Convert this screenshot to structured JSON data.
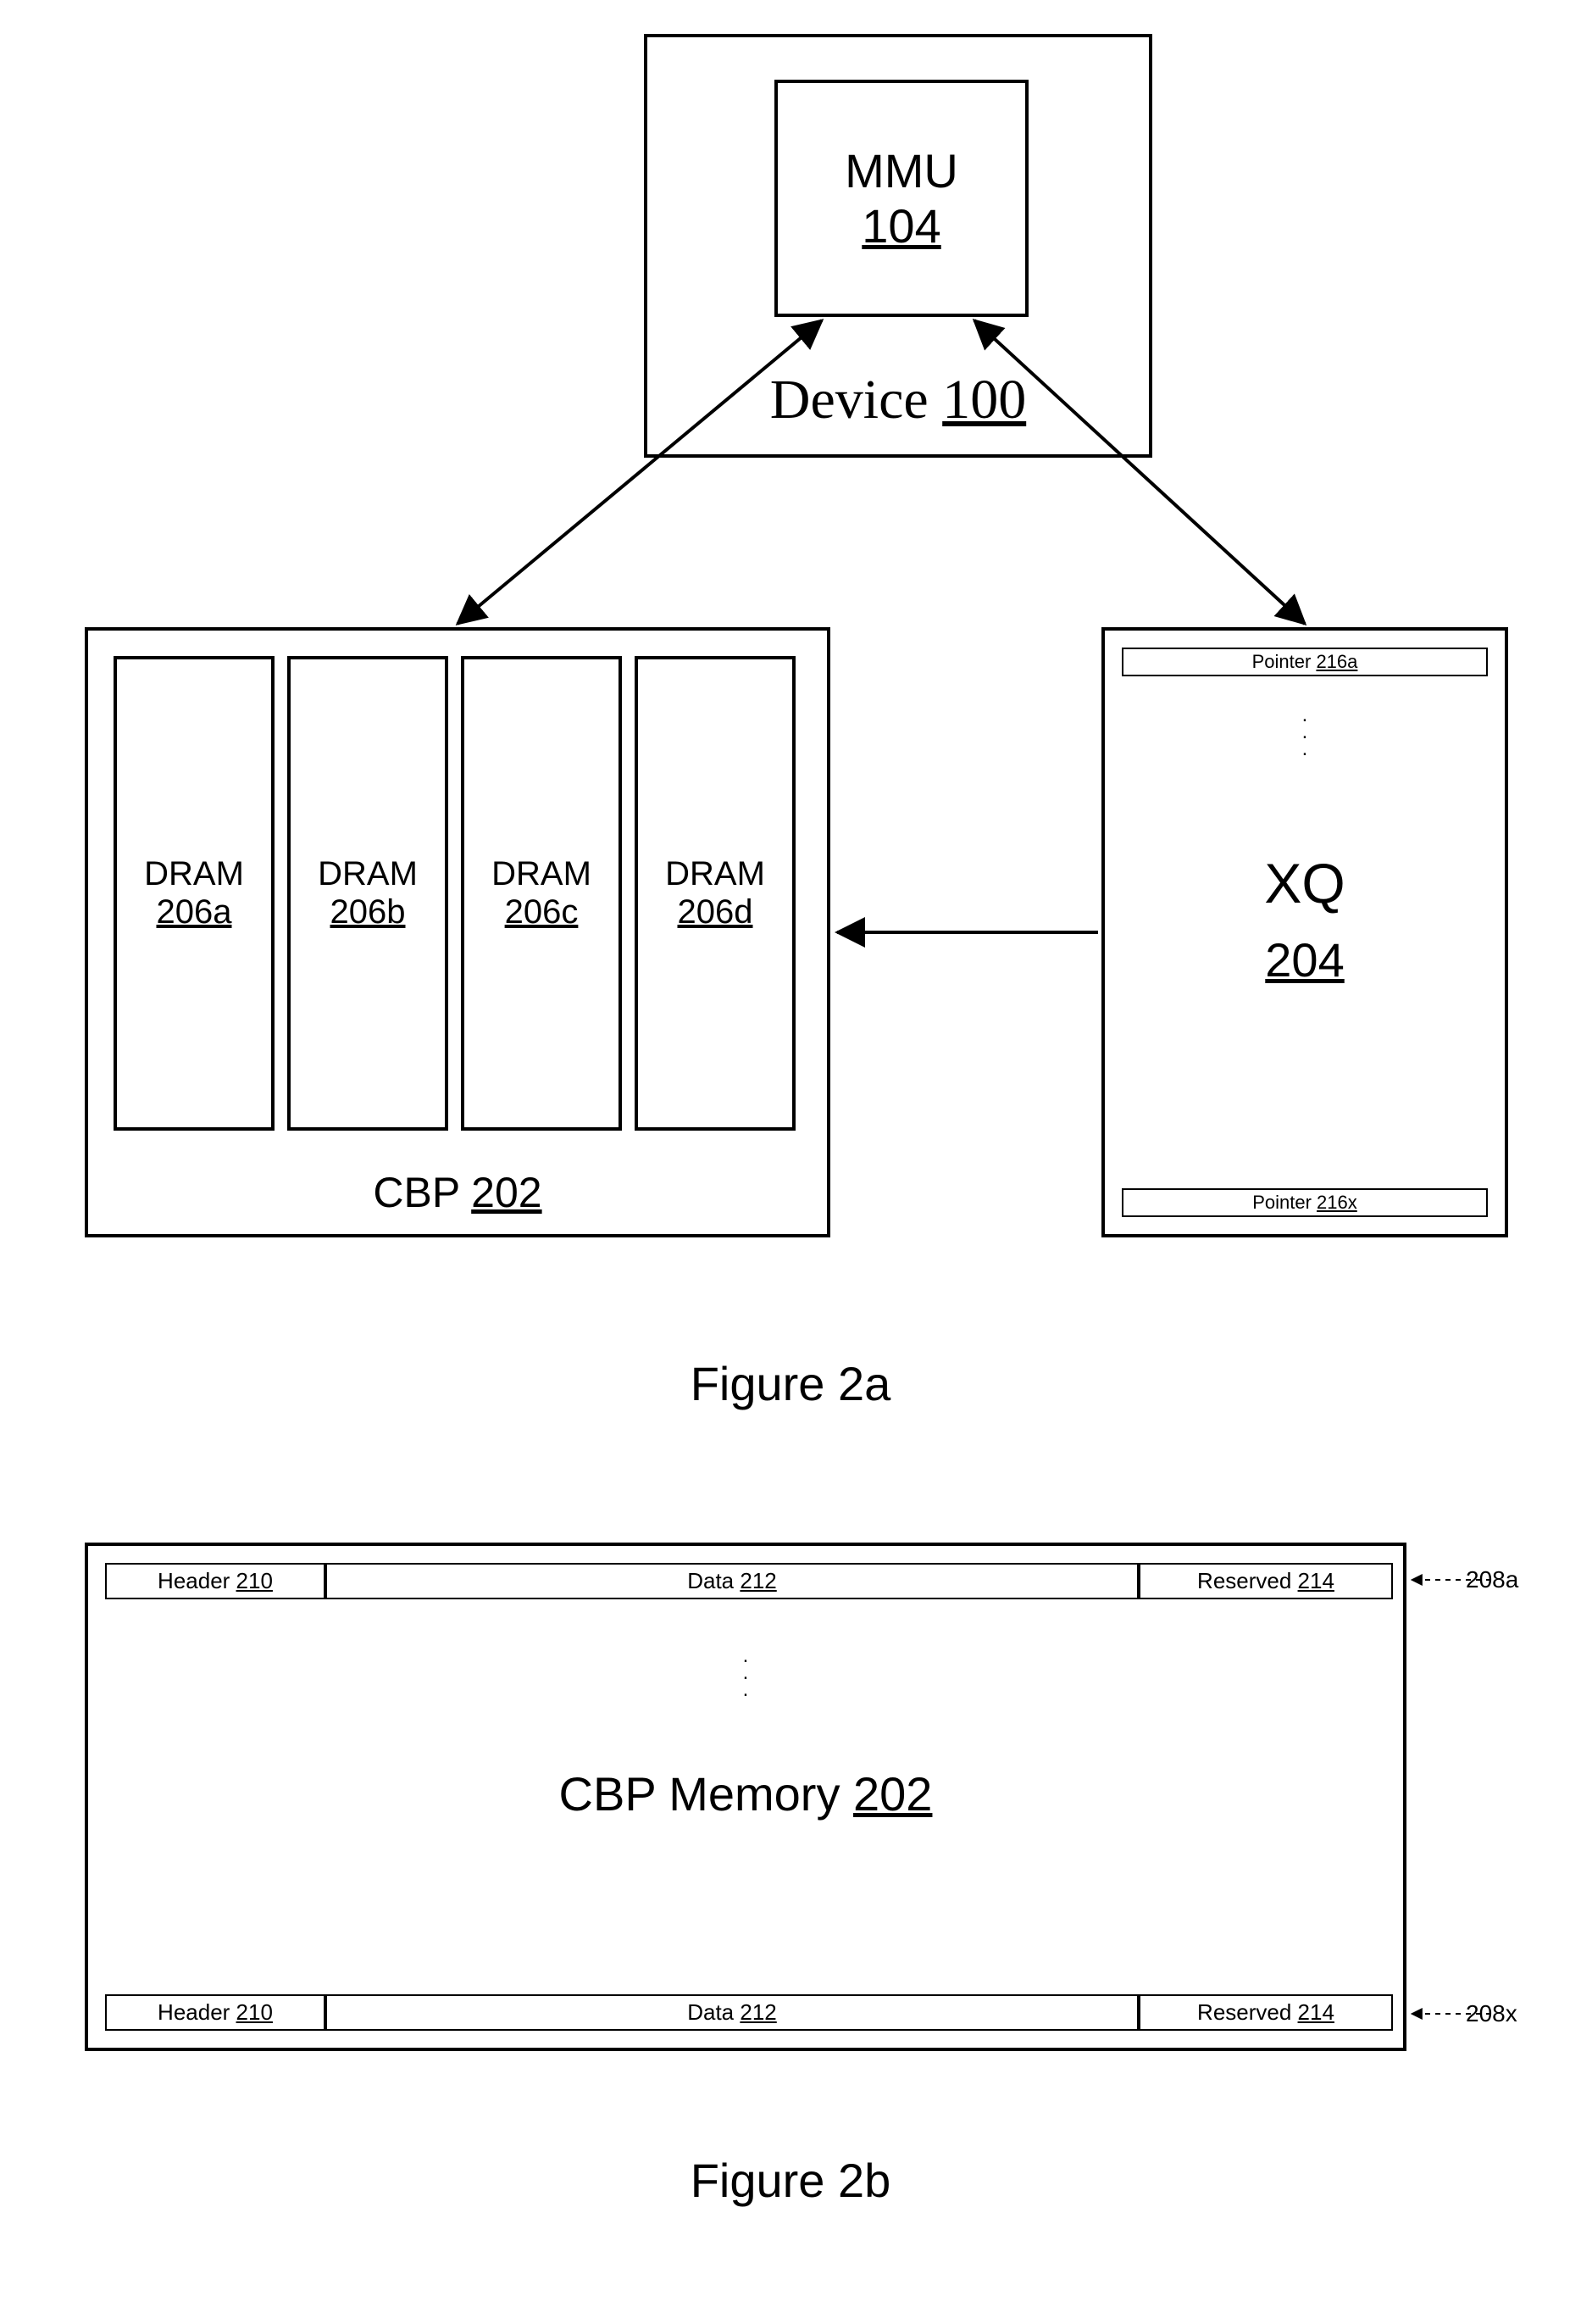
{
  "device": {
    "label_prefix": "Device ",
    "label_num": "100",
    "mmu": {
      "name": "MMU",
      "num": "104"
    }
  },
  "cbp": {
    "label_prefix": "CBP ",
    "label_num": "202",
    "drams": [
      {
        "name": "DRAM",
        "num": "206a"
      },
      {
        "name": "DRAM",
        "num": "206b"
      },
      {
        "name": "DRAM",
        "num": "206c"
      },
      {
        "name": "DRAM",
        "num": "206d"
      }
    ]
  },
  "xq": {
    "name": "XQ",
    "num": "204",
    "pointer_top": {
      "prefix": "Pointer ",
      "num": "216a"
    },
    "pointer_bottom": {
      "prefix": "Pointer ",
      "num": "216x"
    }
  },
  "fig2a": "Figure 2a",
  "cbp_mem": {
    "title_prefix": "CBP Memory ",
    "title_num": "202",
    "row_top_ref": "208a",
    "row_bottom_ref": "208x",
    "header": {
      "prefix": "Header ",
      "num": "210"
    },
    "data": {
      "prefix": "Data ",
      "num": "212"
    },
    "reserved": {
      "prefix": "Reserved ",
      "num": "214"
    }
  },
  "fig2b": "Figure 2b"
}
